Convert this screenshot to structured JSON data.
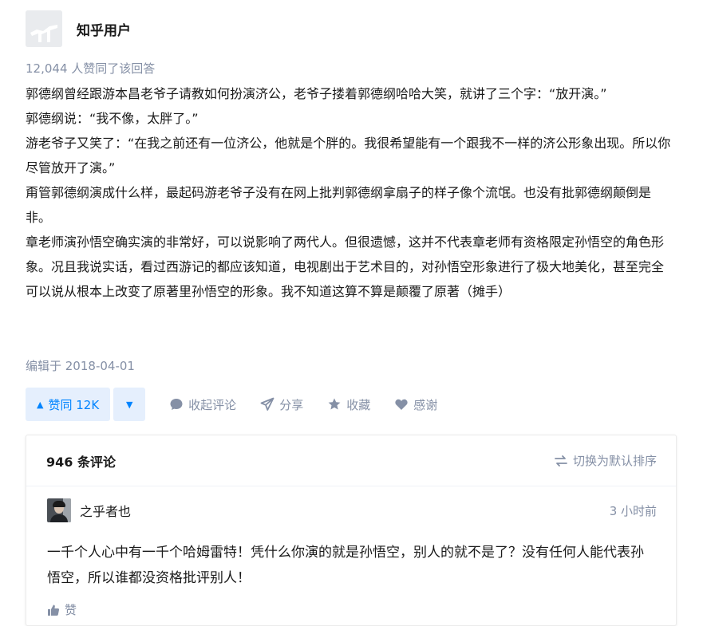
{
  "author": {
    "name": "知乎用户",
    "avatar_icon": "default-avatar-icon"
  },
  "answer": {
    "votes_text": "12,044 人赞同了该回答",
    "paragraphs": [
      "郭德纲曾经跟游本昌老爷子请教如何扮演济公，老爷子搂着郭德纲哈哈大笑，就讲了三个字：“放开演。”",
      "郭德纲说：“我不像，太胖了。”",
      "游老爷子又笑了：“在我之前还有一位济公，他就是个胖的。我很希望能有一个跟我不一样的济公形象出现。所以你尽管放开了演。”",
      "甭管郭德纲演成什么样，最起码游老爷子没有在网上批判郭德纲拿扇子的样子像个流氓。也没有批郭德纲颠倒是非。",
      "章老师演孙悟空确实演的非常好，可以说影响了两代人。但很遗憾，这并不代表章老师有资格限定孙悟空的角色形象。况且我说实话，看过西游记的都应该知道，电视剧出于艺术目的，对孙悟空形象进行了极大地美化，甚至完全可以说从根本上改变了原著里孙悟空的形象。我不知道这算不算是颠覆了原著（摊手）"
    ],
    "edited": "编辑于 2018-04-01"
  },
  "actions": {
    "vote_up": "赞同 12K",
    "collapse_comments": "收起评论",
    "share": "分享",
    "favorite": "收藏",
    "thanks": "感谢"
  },
  "comments": {
    "count_label": "946 条评论",
    "sort_label": "切换为默认排序",
    "items": [
      {
        "user": "之乎者也",
        "time": "3 小时前",
        "text": "一千个人心中有一千个哈姆雷特！凭什么你演的就是孙悟空，别人的就不是了？没有任何人能代表孙悟空，所以谁都没资格批评别人！",
        "like_label": "赞"
      }
    ]
  },
  "colors": {
    "primary": "#0084ff",
    "primary_bg": "#e5effd",
    "muted": "#8590a6",
    "text": "#1a1a1a"
  }
}
